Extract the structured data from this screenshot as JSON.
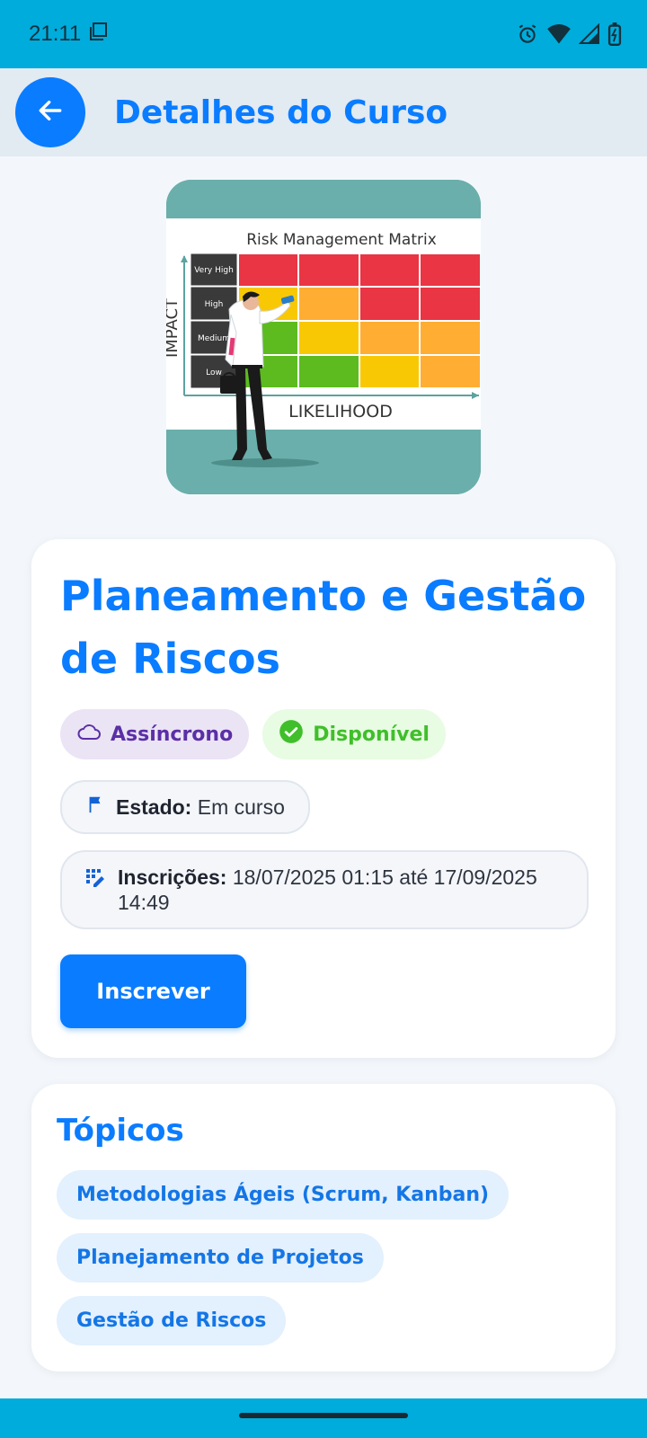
{
  "status_bar": {
    "time": "21:11",
    "icons": [
      "screenshot-icon",
      "alarm-icon",
      "wifi-icon",
      "signal-icon",
      "battery-icon"
    ]
  },
  "app_bar": {
    "title": "Detalhes do Curso",
    "back_icon": "arrow-left-icon"
  },
  "hero": {
    "chart_title": "Risk Management Matrix",
    "y_axis_label": "IMPACT",
    "x_axis_label": "LIKELIHOOD",
    "rows": [
      "Very High",
      "High",
      "Medium",
      "Low"
    ]
  },
  "course": {
    "title": "Planeamento e Gestão de Riscos",
    "badge_mode": "Assíncrono",
    "badge_availability": "Disponível",
    "state_label": "Estado:",
    "state_value": "Em curso",
    "enroll_label": "Inscrições:",
    "enroll_value": "18/07/2025 01:15 até 17/09/2025 14:49",
    "enroll_button": "Inscrever"
  },
  "topics": {
    "title": "Tópicos",
    "items": [
      "Metodologias Ágeis (Scrum, Kanban)",
      "Planejamento de Projetos",
      "Gestão de Riscos"
    ]
  },
  "colors": {
    "accent": "#0a7cff",
    "status_bar": "#00acdb",
    "async_badge": "#5b2fa6",
    "available_badge": "#3fbf2a"
  }
}
